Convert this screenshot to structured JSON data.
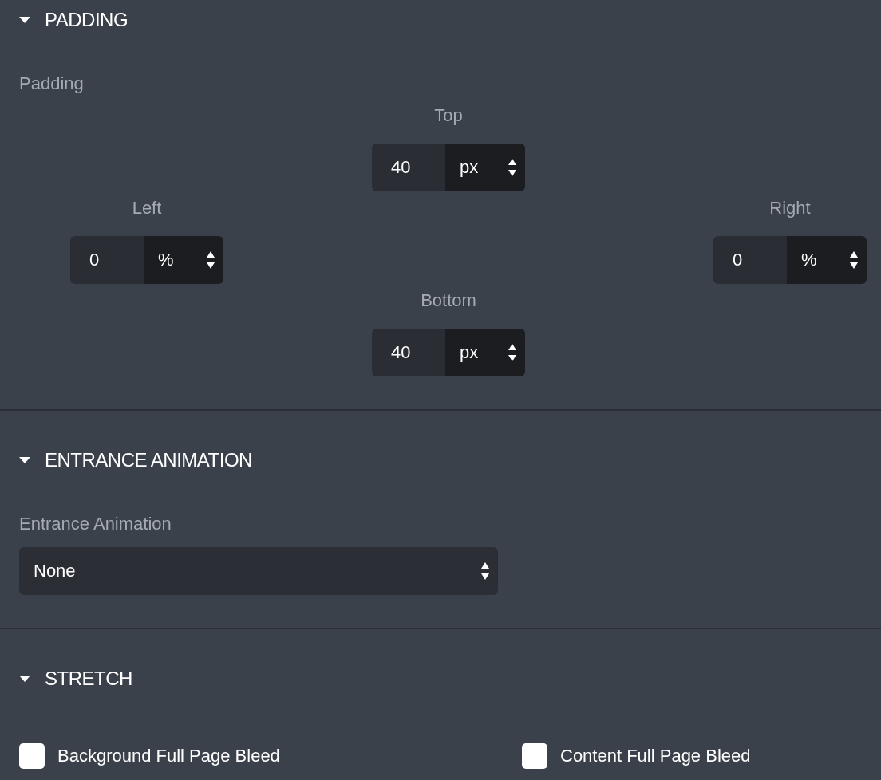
{
  "sections": [
    {
      "kind": "padding",
      "title": "PADDING",
      "expanded": true,
      "label": "Padding",
      "sides": [
        {
          "label": "Top",
          "value": "40",
          "unit": "px"
        },
        {
          "label": "Left",
          "value": "0",
          "unit": "%"
        },
        {
          "label": "Right",
          "value": "0",
          "unit": "%"
        },
        {
          "label": "Bottom",
          "value": "40",
          "unit": "px"
        }
      ]
    },
    {
      "kind": "select",
      "title": "ENTRANCE ANIMATION",
      "expanded": true,
      "label": "Entrance Animation",
      "value": "None"
    },
    {
      "kind": "checkboxes",
      "title": "STRETCH",
      "expanded": true,
      "checkboxes": [
        {
          "label": "Background Full Page Bleed",
          "checked": false
        },
        {
          "label": "Content Full Page Bleed",
          "checked": false
        }
      ]
    }
  ]
}
